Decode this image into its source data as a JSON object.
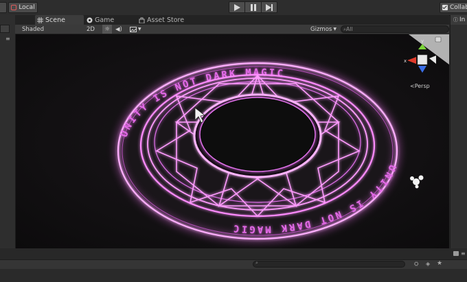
{
  "toolbar": {
    "local_label": "Local",
    "collab_label": "Collab"
  },
  "tabs": {
    "scene": "Scene",
    "game": "Game",
    "asset_store": "Asset Store"
  },
  "scene_toolbar": {
    "shading_mode": "Shaded",
    "mode_2d": "2D",
    "gizmos_label": "Gizmos",
    "search_placeholder": "All"
  },
  "viewport": {
    "projection_label": "Persp",
    "rune_text": "UNITY IS NOT DARK MAGIC",
    "rune_color": "#e060e8",
    "gizmo_axes": {
      "x": "x",
      "y": "y"
    }
  },
  "right_panel": {
    "tab_label": "In"
  },
  "colors": {
    "accent_glow": "#ff7cff",
    "axis_x": "#e03a2a",
    "axis_y": "#7cd43a",
    "axis_z": "#3a6ee8"
  }
}
